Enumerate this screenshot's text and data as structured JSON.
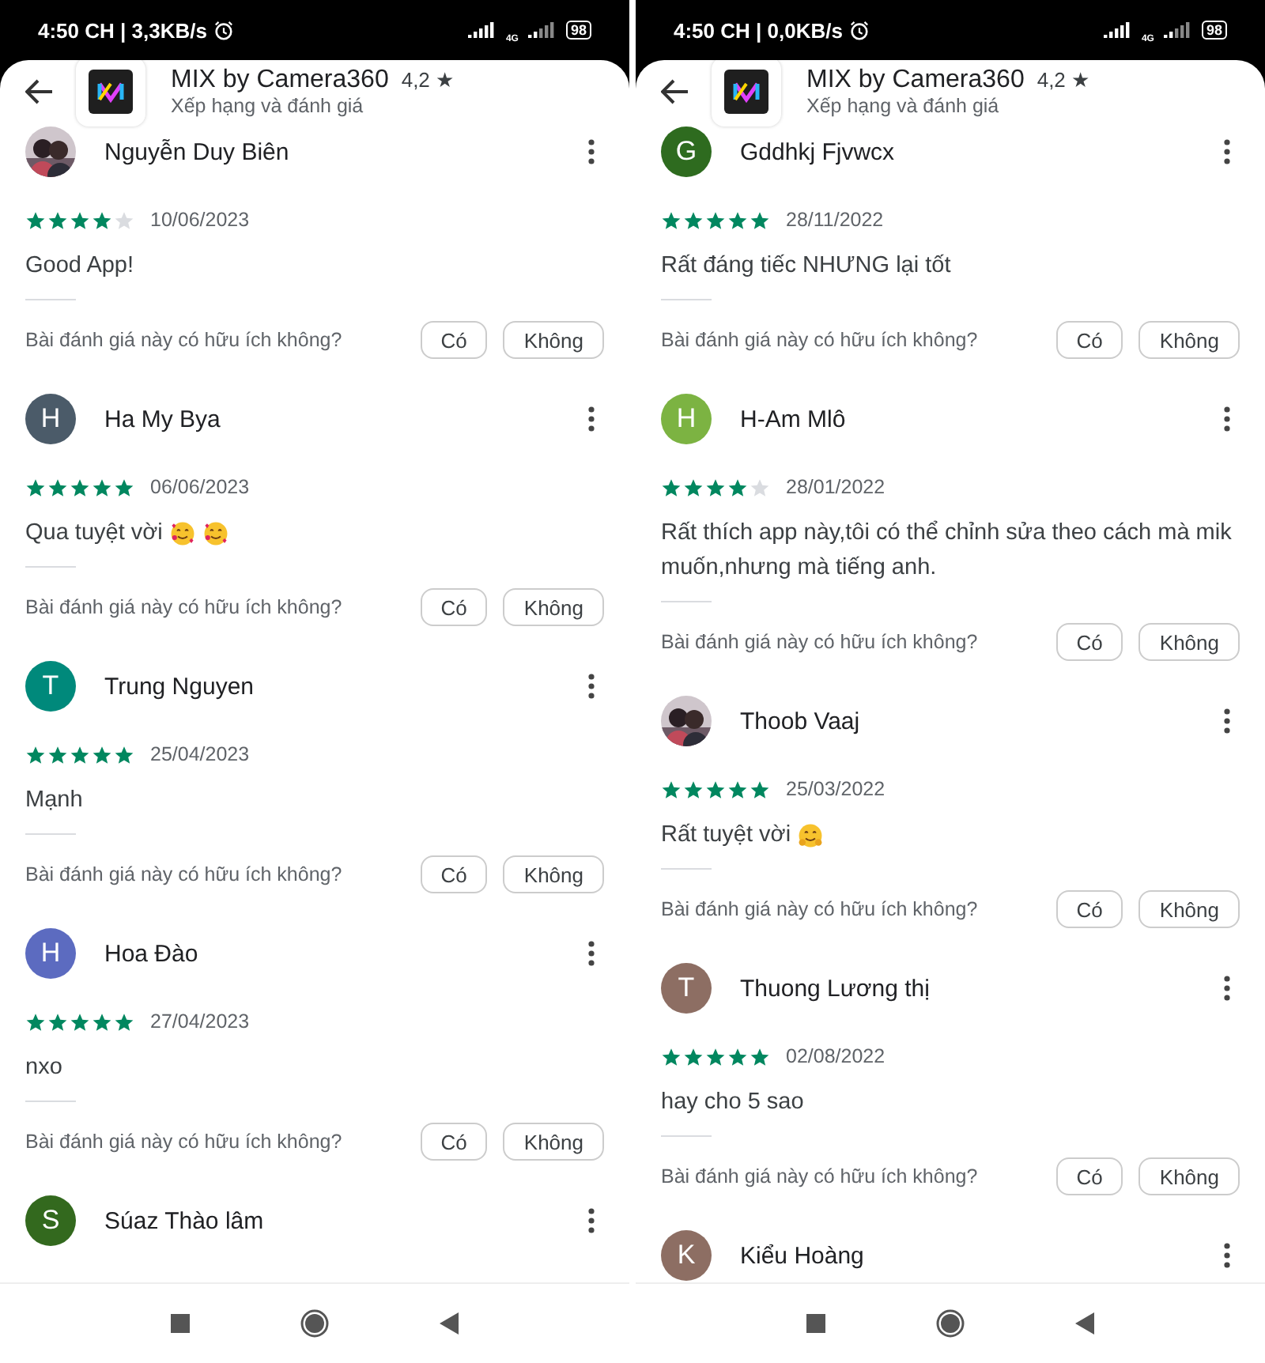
{
  "screens": [
    {
      "status_bar": {
        "text": "4:50 CH | 3,3KB/s",
        "network": "4G",
        "battery": "98"
      },
      "header": {
        "title": "MIX by Camera360",
        "rating": "4,2 ★",
        "subtitle": "Xếp hạng và đánh giá"
      },
      "reviews": [
        {
          "name": "Nguyễn Duy Biên",
          "avatar": {
            "kind": "picture"
          },
          "stars": 4,
          "date": "10/06/2023",
          "text": "Good App!",
          "question": "Bài đánh giá này có hữu ích không?",
          "yes": "Có",
          "no": "Không"
        },
        {
          "name": "Ha My Bya",
          "avatar": {
            "kind": "letter",
            "letter": "H",
            "color": "#4b5b69"
          },
          "stars": 5,
          "date": "06/06/2023",
          "text": "Qua tuyệt vời",
          "emoji": [
            {
              "kind": "smiling-face-with-hearts"
            },
            {
              "kind": "smiling-face-with-hearts"
            }
          ],
          "question": "Bài đánh giá này có hữu ích không?",
          "yes": "Có",
          "no": "Không"
        },
        {
          "name": "Trung Nguyen",
          "avatar": {
            "kind": "letter",
            "letter": "T",
            "color": "#00897b"
          },
          "stars": 5,
          "date": "25/04/2023",
          "text": "Mạnh",
          "question": "Bài đánh giá này có hữu ích không?",
          "yes": "Có",
          "no": "Không"
        },
        {
          "name": "Hoa Đào",
          "avatar": {
            "kind": "letter",
            "letter": "H",
            "color": "#5c6bc0"
          },
          "stars": 5,
          "date": "27/04/2023",
          "text": "nxo",
          "question": "Bài đánh giá này có hữu ích không?",
          "yes": "Có",
          "no": "Không"
        },
        {
          "name": "Súaz Thào lâm",
          "avatar": {
            "kind": "letter",
            "letter": "S",
            "color": "#33691e"
          }
        }
      ]
    },
    {
      "status_bar": {
        "text": "4:50 CH | 0,0KB/s",
        "network": "4G",
        "battery": "98"
      },
      "header": {
        "title": "MIX by Camera360",
        "rating": "4,2 ★",
        "subtitle": "Xếp hạng và đánh giá"
      },
      "reviews": [
        {
          "name": "Gddhkj Fjvwcx",
          "avatar": {
            "kind": "letter",
            "letter": "G",
            "color": "#2e6b1f"
          },
          "stars": 5,
          "date": "28/11/2022",
          "text": "Rất đáng tiếc NHƯNG lại tốt",
          "question": "Bài đánh giá này có hữu ích không?",
          "yes": "Có",
          "no": "Không"
        },
        {
          "name": "H-Am Mlô",
          "avatar": {
            "kind": "letter",
            "letter": "H",
            "color": "#7cb342"
          },
          "stars": 4,
          "date": "28/01/2022",
          "text": "Rất thích app này,tôi có thể chỉnh sửa theo cách mà mik muốn,nhưng mà tiếng anh.",
          "question": "Bài đánh giá này có hữu ích không?",
          "yes": "Có",
          "no": "Không"
        },
        {
          "name": "Thoob Vaaj",
          "avatar": {
            "kind": "picture"
          },
          "stars": 5,
          "date": "25/03/2022",
          "text": "Rất tuyệt vời",
          "emoji": [
            {
              "kind": "hugging-face"
            }
          ],
          "question": "Bài đánh giá này có hữu ích không?",
          "yes": "Có",
          "no": "Không"
        },
        {
          "name": "Thuong Lương thị",
          "avatar": {
            "kind": "letter",
            "letter": "T",
            "color": "#8d6e63"
          },
          "stars": 5,
          "date": "02/08/2022",
          "text": "hay cho 5 sao",
          "question": "Bài đánh giá này có hữu ích không?",
          "yes": "Có",
          "no": "Không"
        },
        {
          "name": "Kiểu Hoàng",
          "avatar": {
            "kind": "letter",
            "letter": "K",
            "color": "#8d6e63"
          }
        }
      ]
    }
  ]
}
